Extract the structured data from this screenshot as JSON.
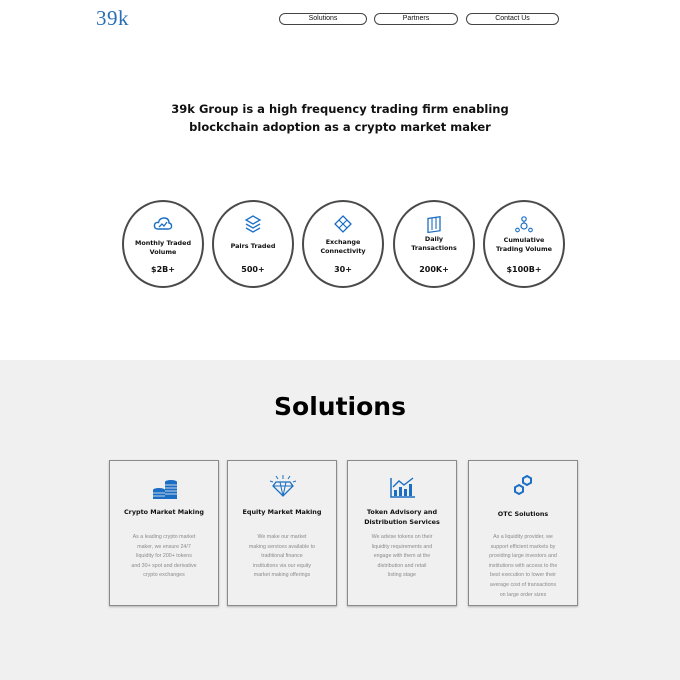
{
  "brand": {
    "logo_text": "39k",
    "accent_color": "#2a6fb5"
  },
  "nav": {
    "solutions_label": "Solutions",
    "partners_label": "Partners",
    "contact_label": "Contact Us"
  },
  "hero": {
    "line1": "39k Group is a high frequency trading firm enabling",
    "line2": "blockchain adoption as a crypto market maker"
  },
  "stats": [
    {
      "icon": "cloud-chart-icon",
      "label_line1": "Monthly Traded",
      "label_line2": "Volume",
      "value": "$2B+"
    },
    {
      "icon": "layers-icon",
      "label_line1": "Pairs Traded",
      "label_line2": "",
      "value": "500+"
    },
    {
      "icon": "network-diamond-icon",
      "label_line1": "Exchange",
      "label_line2": "Connectivity",
      "value": "30+"
    },
    {
      "icon": "blocks-icon",
      "label_line1": "Daily",
      "label_line2": "Transactions",
      "value": "200K+"
    },
    {
      "icon": "people-network-icon",
      "label_line1": "Cumulative",
      "label_line2": "Trading Volume",
      "value": "$100B+"
    }
  ],
  "solutions": {
    "title": "Solutions",
    "cards": [
      {
        "icon": "coins-icon",
        "title_line1": "Crypto Market Making",
        "title_line2": "",
        "desc": [
          "As a leading crypto market",
          "maker, we ensure 24/7",
          "liquidity for 200+ tokens",
          "and 30+ spot and derivative",
          "crypto exchanges"
        ]
      },
      {
        "icon": "diamond-icon",
        "title_line1": "Equity Market Making",
        "title_line2": "",
        "desc": [
          "We make our market",
          "making services available to",
          "traditional finance",
          "institutions via our equity",
          "market making offerings"
        ]
      },
      {
        "icon": "growth-chart-icon",
        "title_line1": "Token Advisory and",
        "title_line2": "Distribution Services",
        "desc": [
          "We advise tokens on their",
          "liquidity requirements and",
          "engage with them at the",
          "distribution and retail",
          "listing stage"
        ]
      },
      {
        "icon": "hexagon-link-icon",
        "title_line1": "OTC Solutions",
        "title_line2": "",
        "desc": [
          "As a liquidity provider, we",
          "support efficient markets by",
          "providing large investors and",
          "institutions with access to the",
          "best execution to lower their",
          "average cost of transactions",
          "on large order sizes"
        ]
      }
    ]
  }
}
